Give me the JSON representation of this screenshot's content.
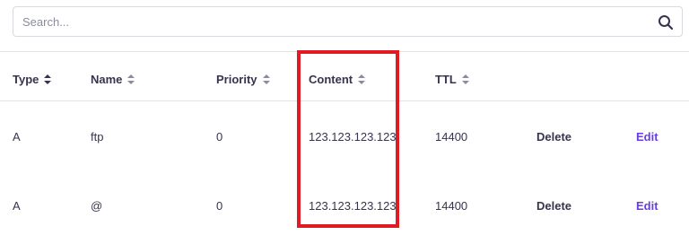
{
  "search": {
    "placeholder": "Search..."
  },
  "columns": [
    {
      "label": "Type"
    },
    {
      "label": "Name"
    },
    {
      "label": "Priority"
    },
    {
      "label": "Content"
    },
    {
      "label": "TTL"
    }
  ],
  "rows": [
    {
      "type": "A",
      "name": "ftp",
      "priority": "0",
      "content": "123.123.123.123",
      "ttl": "14400",
      "delete": "Delete",
      "edit": "Edit"
    },
    {
      "type": "A",
      "name": "@",
      "priority": "0",
      "content": "123.123.123.123",
      "ttl": "14400",
      "delete": "Delete",
      "edit": "Edit"
    }
  ],
  "colors": {
    "accent": "#673de6",
    "highlight": "#e01b24",
    "text": "#36344d"
  }
}
